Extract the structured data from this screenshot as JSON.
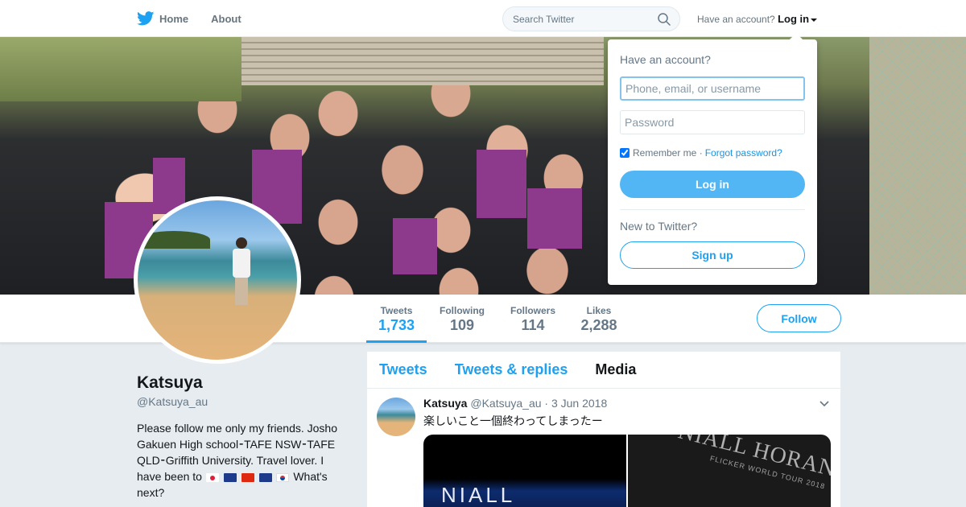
{
  "nav": {
    "home_label": "Home",
    "about_label": "About",
    "search_placeholder": "Search Twitter",
    "have_account_text": "Have an account?",
    "login_label": "Log in"
  },
  "profile": {
    "name": "Katsuya",
    "handle": "@Katsuya_au",
    "bio_text": "Please follow me only my friends. Josho Gakuen High school⁃TAFE NSW⁃TAFE QLD⁃Griffith University. Travel lover. I have been to",
    "bio_flags": [
      "japan-flag",
      "australia-flag",
      "china-flag",
      "new-zealand-flag",
      "korea-flag"
    ],
    "bio_tail": "What's next?"
  },
  "stats": [
    {
      "label": "Tweets",
      "value": "1,733"
    },
    {
      "label": "Following",
      "value": "109"
    },
    {
      "label": "Followers",
      "value": "114"
    },
    {
      "label": "Likes",
      "value": "2,288"
    }
  ],
  "follow_label": "Follow",
  "timeline": {
    "tabs": [
      "Tweets",
      "Tweets & replies",
      "Media"
    ],
    "tweet": {
      "name": "Katsuya",
      "handle": "@Katsuya_au",
      "separator": "·",
      "date": "3 Jun 2018",
      "text": "楽しいこと一個終わってしまったー",
      "media_text_1": "NIALL",
      "media_text_2": "NIALL HORAN",
      "media_text_3": "FLICKER WORLD TOUR 2018"
    }
  },
  "login_dropdown": {
    "title": "Have an account?",
    "username_placeholder": "Phone, email, or username",
    "password_placeholder": "Password",
    "remember_label": "Remember me",
    "separator": "·",
    "forgot_label": "Forgot password?",
    "login_button": "Log in",
    "new_text": "New to Twitter?",
    "signup_button": "Sign up"
  },
  "colors": {
    "accent": "#1da1f2",
    "login_button": "#52b6f5",
    "page_bg": "#e6ecf0"
  }
}
